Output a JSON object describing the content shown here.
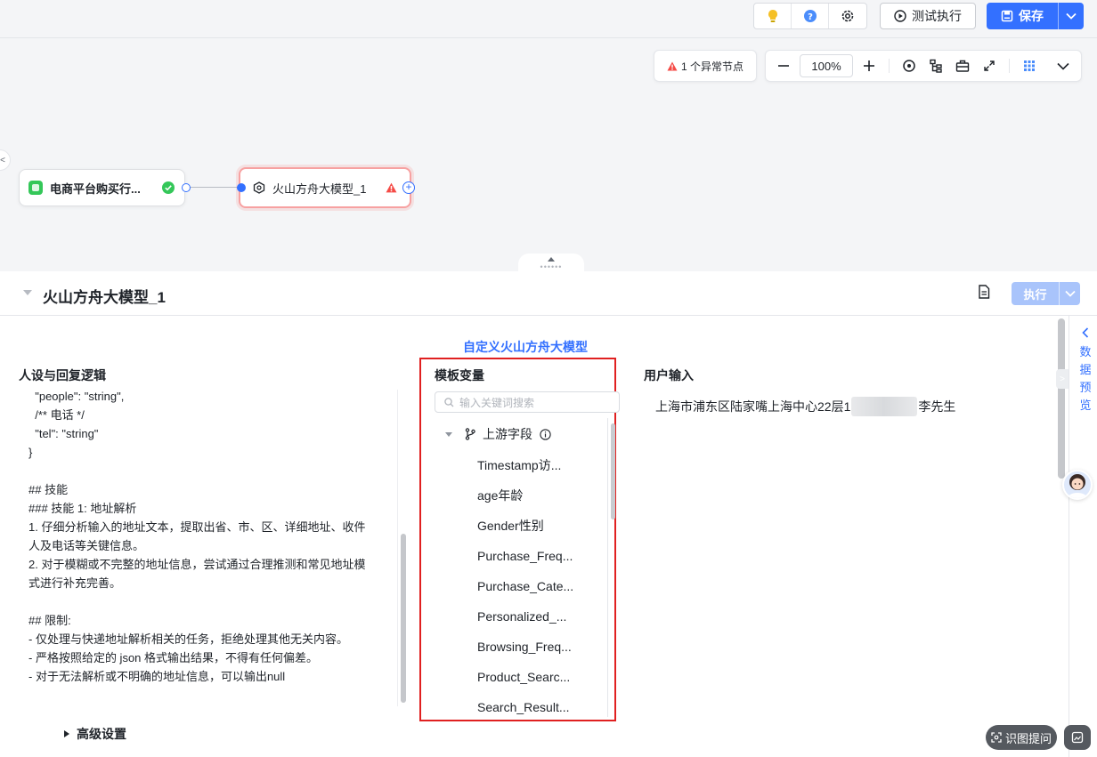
{
  "toolbar": {
    "test_run_label": "测试执行",
    "save_label": "保存",
    "icons": [
      "lightbulb-icon",
      "help-icon",
      "gear-icon"
    ]
  },
  "canvas": {
    "abnormal_nodes_label": "1 个异常节点",
    "zoom_level": "100%",
    "nodes": [
      {
        "label": "电商平台购买行...",
        "status": "success"
      },
      {
        "label": "火山方舟大模型_1",
        "status": "error"
      }
    ]
  },
  "panel": {
    "title": "火山方舟大模型_1",
    "run_label": "执行",
    "model_link": "自定义火山方舟大模型",
    "persona": {
      "title": "人设与回复逻辑",
      "lines": [
        "  \"people\": \"string\",",
        "  /** 电话 */",
        "  \"tel\": \"string\"",
        "}",
        "",
        "## 技能",
        "### 技能 1: 地址解析",
        "1. 仔细分析输入的地址文本，提取出省、市、区、详细地址、收件",
        "人及电话等关键信息。",
        "2. 对于模糊或不完整的地址信息，尝试通过合理推测和常见地址模",
        "式进行补充完善。",
        "",
        "## 限制:",
        "- 仅处理与快递地址解析相关的任务，拒绝处理其他无关内容。",
        "- 严格按照给定的 json 格式输出结果，不得有任何偏差。",
        "- 对于无法解析或不明确的地址信息，可以输出null"
      ]
    },
    "advanced_label": "高级设置",
    "template_vars": {
      "title": "模板变量",
      "search_placeholder": "输入关键词搜索",
      "upstream_label": "上游字段",
      "items": [
        "Timestamp访...",
        "age年龄",
        "Gender性别",
        "Purchase_Freq...",
        "Purchase_Cate...",
        "Personalized_...",
        "Browsing_Freq...",
        "Product_Searc...",
        "Search_Result..."
      ]
    },
    "user_input": {
      "title": "用户输入",
      "text_before": "上海市浦东区陆家嘴上海中心22层1",
      "text_after": "李先生"
    },
    "side_rail_label": [
      "数",
      "据",
      "预",
      "览"
    ]
  },
  "floating": {
    "ask_label": "识图提问"
  },
  "colors": {
    "accent": "#3370ff",
    "error": "#f54a45",
    "success": "#34c759",
    "highlight_box": "#e02020"
  }
}
